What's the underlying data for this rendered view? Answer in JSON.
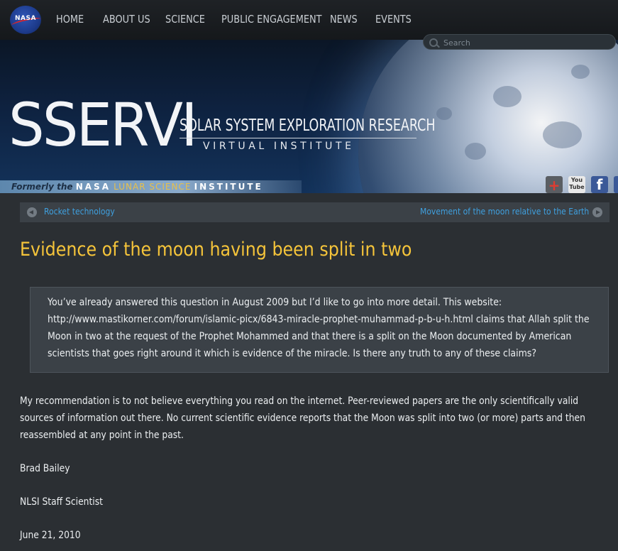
{
  "header": {
    "logo_text": "NASA",
    "nav": [
      "HOME",
      "ABOUT US",
      "SCIENCE",
      "PUBLIC ENGAGEMENT",
      "NEWS",
      "EVENTS"
    ],
    "search_placeholder": "Search"
  },
  "banner": {
    "logo": "SSERVI",
    "tagline_1": "SOLAR SYSTEM EXPLORATION RESEARCH",
    "tagline_2": "VIRTUAL INSTITUTE",
    "formerly_prefix": "Formerly the",
    "formerly_nasa": "NASA",
    "formerly_lunar": "LUNAR SCIENCE",
    "formerly_institute": "INSTITUTE",
    "social": [
      "google-plus",
      "youtube",
      "facebook"
    ],
    "youtube_text": "You Tube"
  },
  "post_nav": {
    "prev": "Rocket technology",
    "next": "Movement of the moon relative to the Earth"
  },
  "article": {
    "title": "Evidence of the moon having been split in two",
    "question": "You’ve already answered this question in August 2009 but I’d like to go into more detail. This website: http://www.mastikorner.com/forum/islamic-picx/6843-miracle-prophet-muhammad-p-b-u-h.html claims that Allah split the Moon in two at the request of the Prophet Mohammed and that there is a split on the Moon documented by American scientists that goes right around it which is evidence of the miracle. Is there any truth to any of these claims?",
    "answer": "My recommendation is to not believe everything you read on the internet. Peer-reviewed papers are the only scientifically valid sources of information out there. No current scientific evidence reports that the Moon was split into two (or more) parts and then reassembled at any point in the past.",
    "author": "Brad Bailey",
    "role": "NLSI Staff Scientist",
    "date": "June 21, 2010"
  },
  "colors": {
    "title": "#f5c43a",
    "link": "#3fa0df",
    "background": "#2b2f33",
    "panel": "#3b4147"
  }
}
